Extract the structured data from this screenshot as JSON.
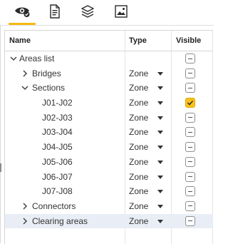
{
  "toolbar": {
    "tabs": [
      {
        "icon": "eye-check-icon",
        "active": true
      },
      {
        "icon": "document-list-icon",
        "active": false
      },
      {
        "icon": "layers-icon",
        "active": false
      },
      {
        "icon": "image-frame-icon",
        "active": false
      }
    ],
    "accent_color": "#f6b912"
  },
  "table": {
    "headers": {
      "name": "Name",
      "type": "Type",
      "visible": "Visible"
    },
    "rows": [
      {
        "label": "Areas list",
        "level": 0,
        "expander": "expanded",
        "type": "",
        "visible": "mixed"
      },
      {
        "label": "Bridges",
        "level": 1,
        "expander": "collapsed",
        "type": "Zone",
        "visible": "mixed"
      },
      {
        "label": "Sections",
        "level": 1,
        "expander": "expanded",
        "type": "Zone",
        "visible": "mixed"
      },
      {
        "label": "J01-J02",
        "level": 2,
        "expander": "none",
        "type": "Zone",
        "visible": "checked"
      },
      {
        "label": "J02-J03",
        "level": 2,
        "expander": "none",
        "type": "Zone",
        "visible": "mixed"
      },
      {
        "label": "J03-J04",
        "level": 2,
        "expander": "none",
        "type": "Zone",
        "visible": "mixed"
      },
      {
        "label": "J04-J05",
        "level": 2,
        "expander": "none",
        "type": "Zone",
        "visible": "mixed"
      },
      {
        "label": "J05-J06",
        "level": 2,
        "expander": "none",
        "type": "Zone",
        "visible": "mixed"
      },
      {
        "label": "J06-J07",
        "level": 2,
        "expander": "none",
        "type": "Zone",
        "visible": "mixed"
      },
      {
        "label": "J07-J08",
        "level": 2,
        "expander": "none",
        "type": "Zone",
        "visible": "mixed"
      },
      {
        "label": "Connectors",
        "level": 1,
        "expander": "collapsed",
        "type": "Zone",
        "visible": "mixed"
      },
      {
        "label": "Clearing areas",
        "level": 1,
        "expander": "collapsed",
        "type": "Zone",
        "visible": "mixed",
        "selected": true
      }
    ]
  }
}
